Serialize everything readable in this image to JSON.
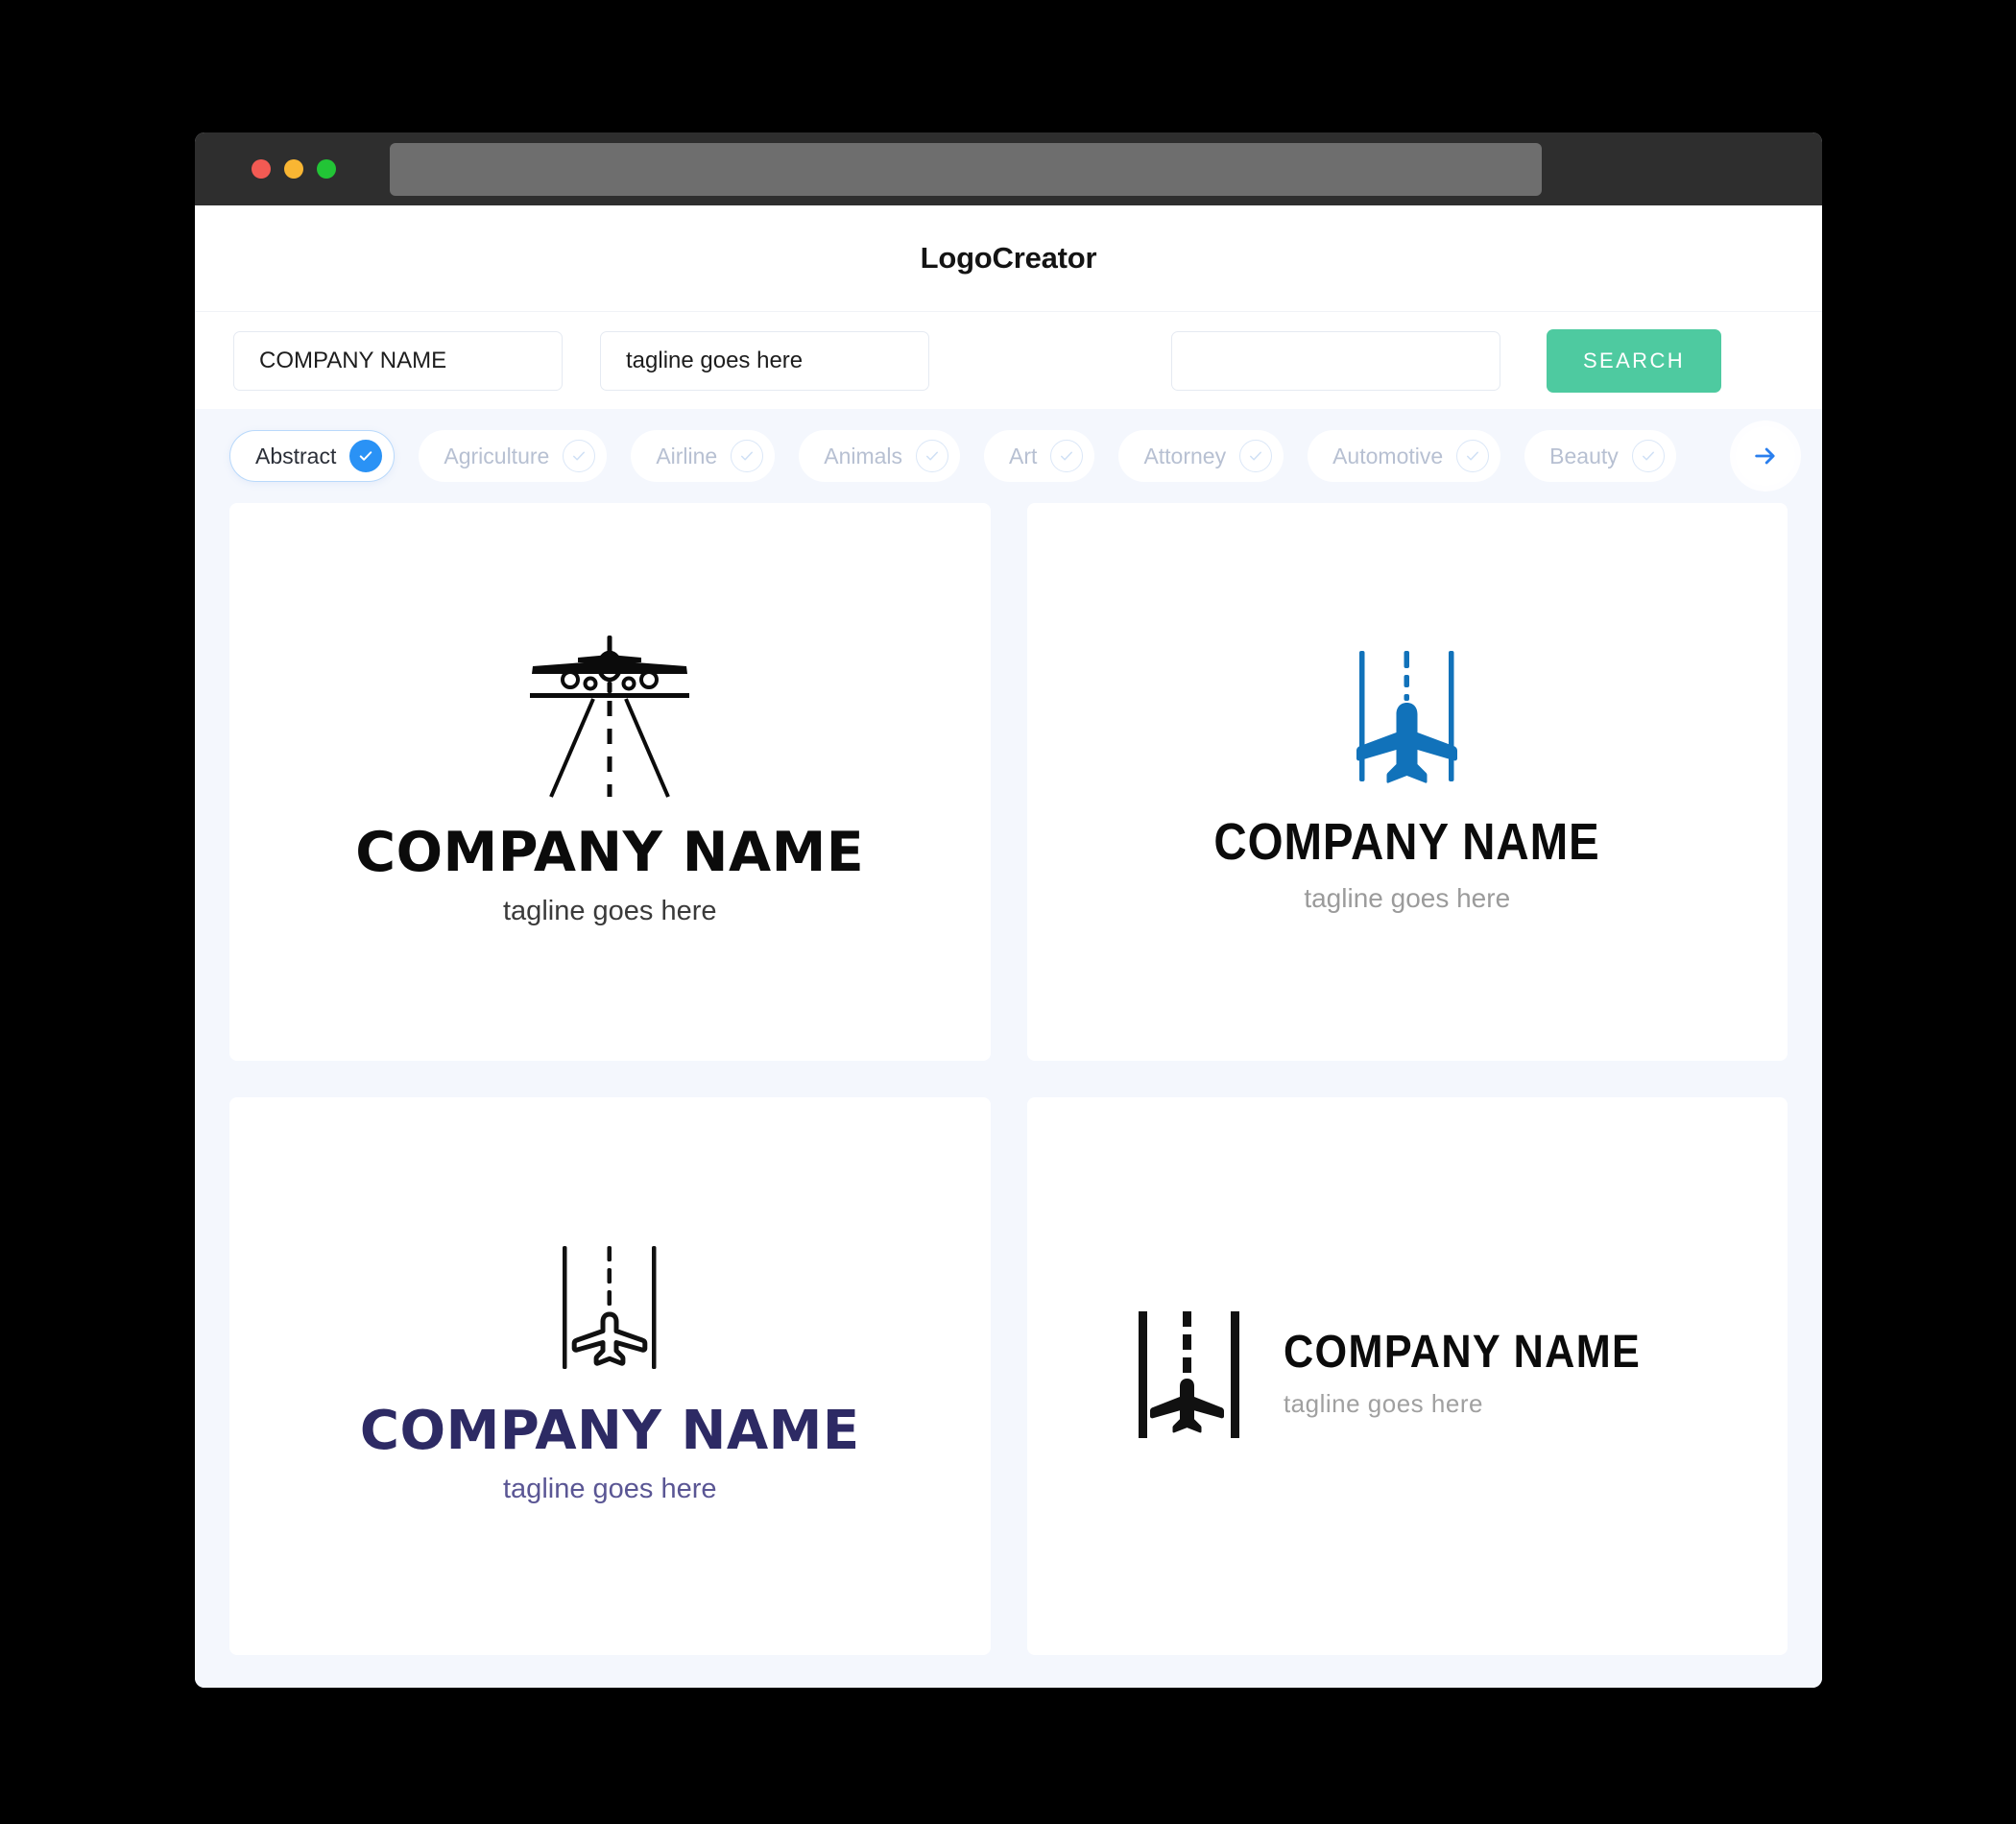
{
  "window": {
    "traffic_lights": [
      {
        "name": "close",
        "color": "#f25a53"
      },
      {
        "name": "minimize",
        "color": "#f9b633"
      },
      {
        "name": "maximize",
        "color": "#22c436"
      }
    ],
    "url_value": ""
  },
  "header": {
    "brand": "LogoCreator"
  },
  "search": {
    "company_value": "COMPANY NAME",
    "company_placeholder": "COMPANY NAME",
    "tagline_value": "tagline goes here",
    "tagline_placeholder": "tagline goes here",
    "extra_value": "",
    "extra_placeholder": "",
    "button_label": "SEARCH",
    "button_color": "#4ecaa0"
  },
  "categories": {
    "accent_color": "#2a92f5",
    "next_label": "next-categories",
    "items": [
      {
        "label": "Abstract",
        "selected": true
      },
      {
        "label": "Agriculture",
        "selected": false
      },
      {
        "label": "Airline",
        "selected": false
      },
      {
        "label": "Animals",
        "selected": false
      },
      {
        "label": "Art",
        "selected": false
      },
      {
        "label": "Attorney",
        "selected": false
      },
      {
        "label": "Automotive",
        "selected": false
      },
      {
        "label": "Beauty",
        "selected": false
      }
    ]
  },
  "logos": [
    {
      "id": "logo-airplane-runway-perspective",
      "name": "COMPANY NAME",
      "tagline": "tagline goes here",
      "name_color": "#0b0b0b",
      "tagline_color": "#3a3a3a",
      "icon_color": "#0b0b0b",
      "layout": "stacked"
    },
    {
      "id": "logo-airplane-blue-runway",
      "name": "COMPANY NAME",
      "tagline": "tagline goes here",
      "name_color": "#0b0b0b",
      "tagline_color": "#9b9b9b",
      "icon_color": "#1172ba",
      "layout": "stacked"
    },
    {
      "id": "logo-airplane-outline-runway",
      "name": "COMPANY NAME",
      "tagline": "tagline goes here",
      "name_color": "#2d2a64",
      "tagline_color": "#5a5694",
      "icon_color": "#111111",
      "layout": "stacked"
    },
    {
      "id": "logo-airplane-runway-horizontal",
      "name": "COMPANY NAME",
      "tagline": "tagline goes here",
      "name_color": "#0b0b0b",
      "tagline_color": "#a0a0a0",
      "icon_color": "#111111",
      "layout": "horizontal"
    }
  ]
}
